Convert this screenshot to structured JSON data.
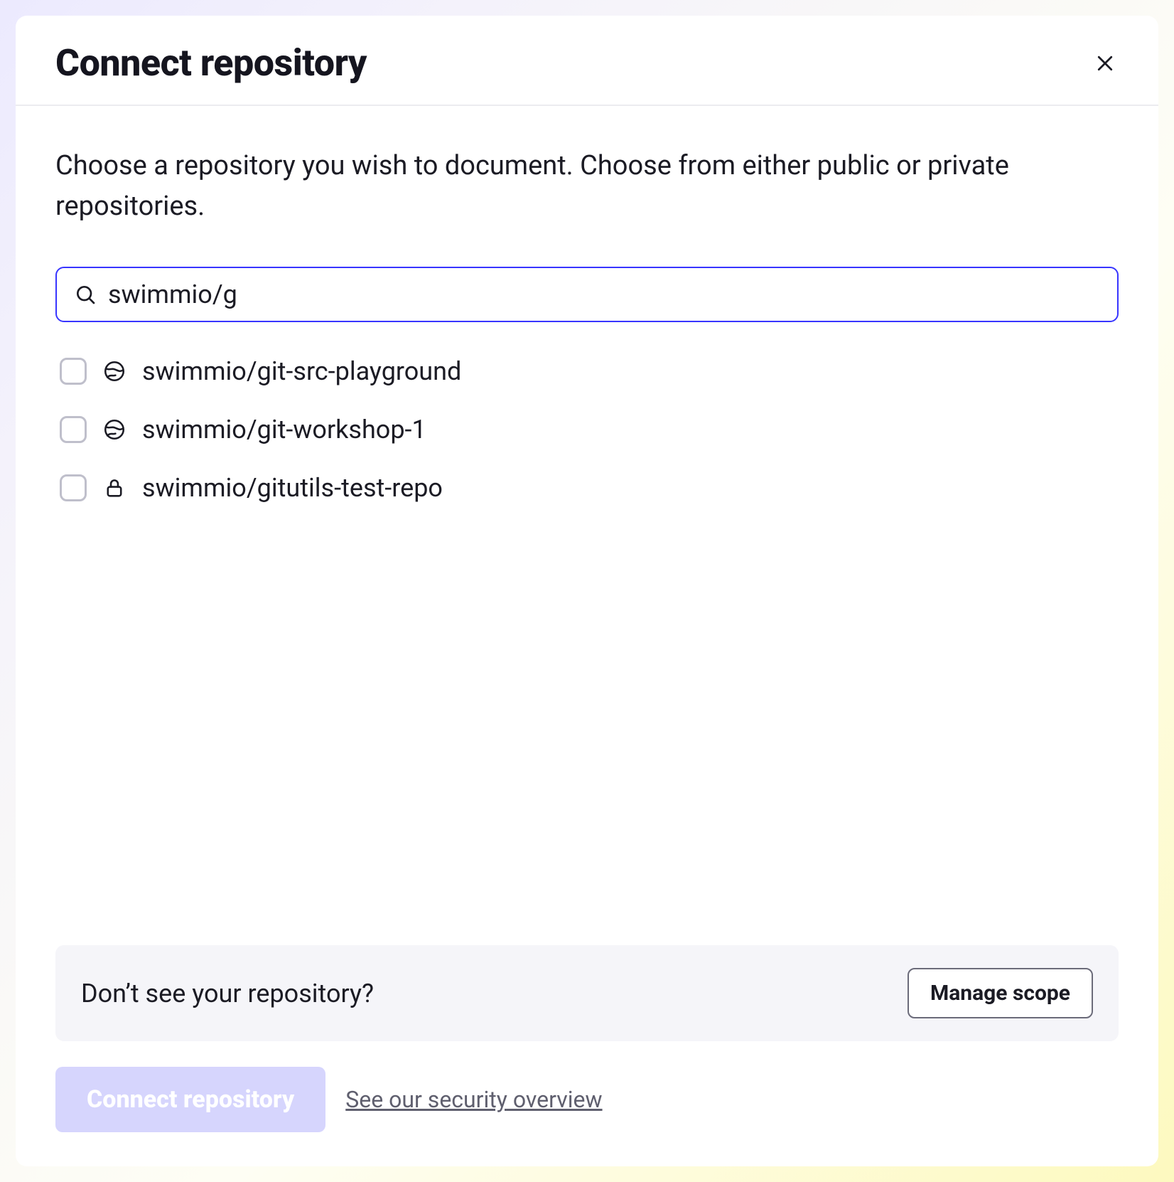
{
  "header": {
    "title": "Connect repository"
  },
  "description": "Choose a repository you wish to document. Choose from either public or private repositories.",
  "search": {
    "value": "swimmio/g"
  },
  "repos": [
    {
      "name": "swimmio/git-src-playground",
      "visibility": "public"
    },
    {
      "name": "swimmio/git-workshop-1",
      "visibility": "public"
    },
    {
      "name": "swimmio/gitutils-test-repo",
      "visibility": "private"
    }
  ],
  "scope": {
    "prompt": "Don’t see your repository?",
    "manage_label": "Manage scope"
  },
  "footer": {
    "connect_label": "Connect repository",
    "security_link": "See our security overview"
  }
}
